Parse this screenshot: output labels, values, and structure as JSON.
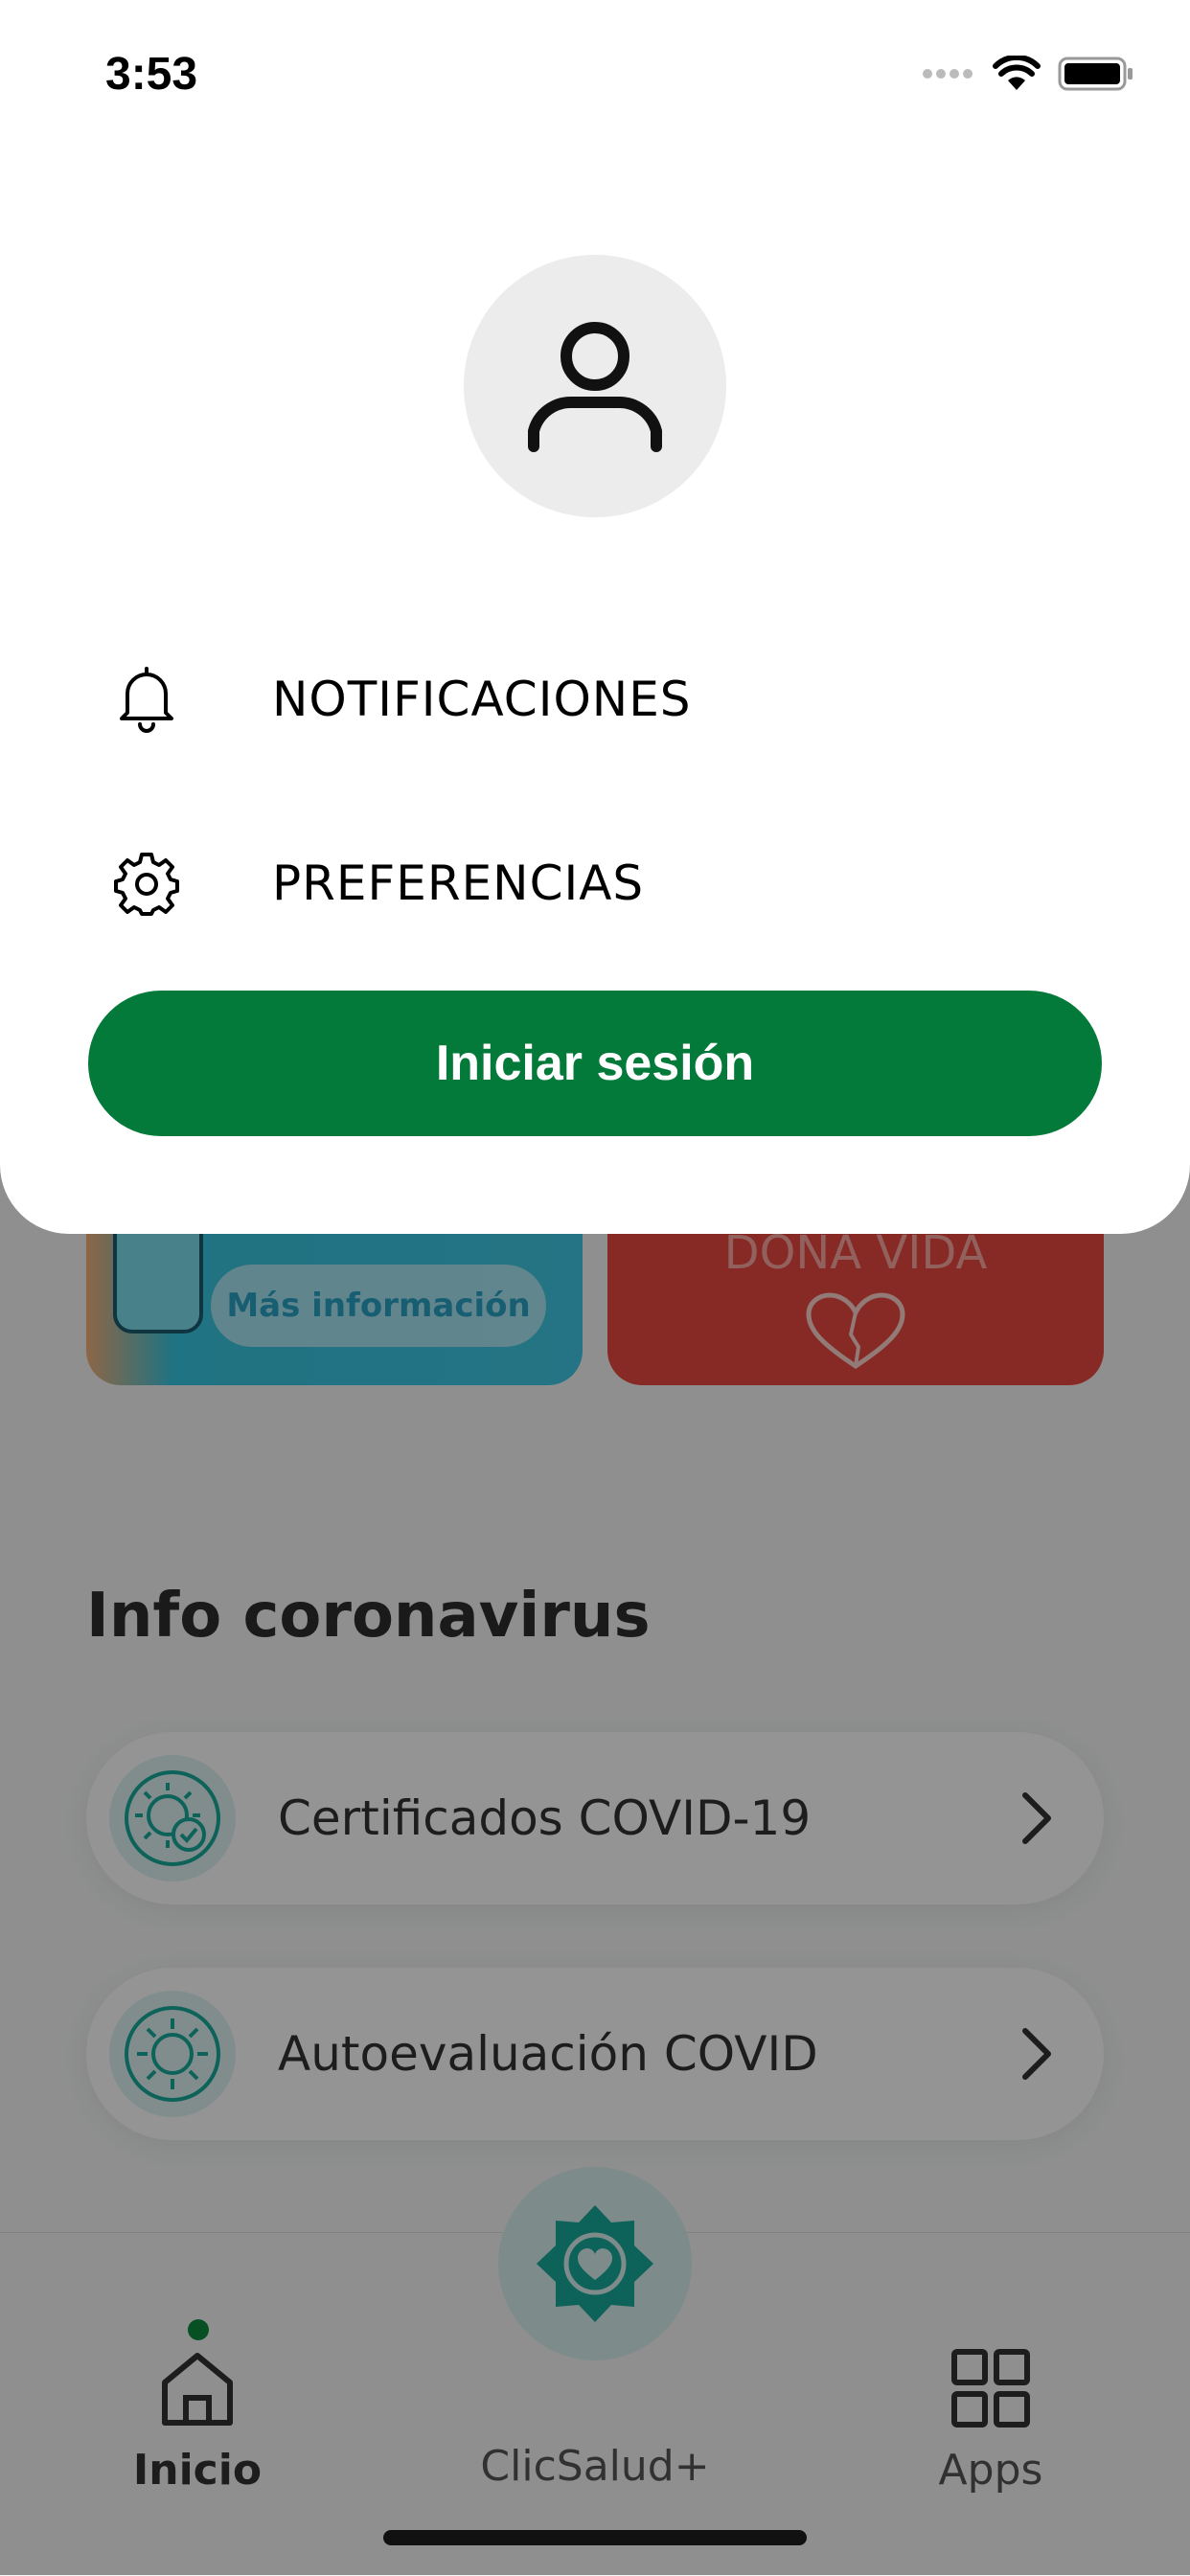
{
  "status_bar": {
    "time": "3:53"
  },
  "menu": {
    "items": [
      {
        "label": "NOTIFICACIONES",
        "icon": "bell-icon"
      },
      {
        "label": "PREFERENCIAS",
        "icon": "gear-icon"
      }
    ],
    "login_button": "Iniciar sesión"
  },
  "background": {
    "banner_left_button": "Más información",
    "banner_right_text": "DONA VIDA",
    "section_title": "Info coronavirus",
    "rows": [
      {
        "label": "Certificados COVID-19",
        "icon": "virus-check-icon"
      },
      {
        "label": "Autoevaluación COVID",
        "icon": "virus-icon"
      }
    ],
    "tabs": [
      {
        "label": "Inicio",
        "icon": "home-icon",
        "active": true
      },
      {
        "label": "ClicSalud+",
        "icon": "heart-badge-icon"
      },
      {
        "label": "Apps",
        "icon": "grid-icon"
      }
    ]
  },
  "colors": {
    "primary_green": "#047a3a",
    "teal_accent": "#18a99a",
    "banner_red": "#e8473f"
  }
}
